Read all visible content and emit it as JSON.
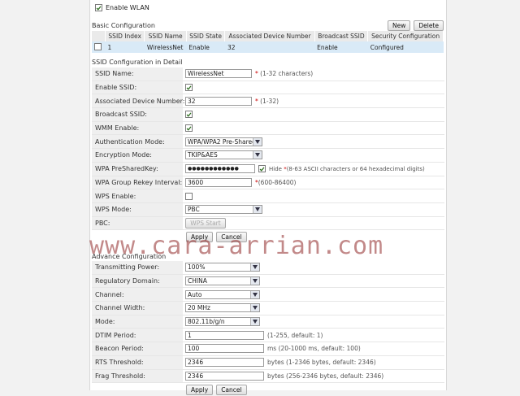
{
  "enable_wlan": {
    "label": "Enable WLAN",
    "checked": true
  },
  "basic": {
    "title": "Basic Configuration",
    "new_label": "New",
    "delete_label": "Delete",
    "columns": [
      "SSID Index",
      "SSID Name",
      "SSID State",
      "Associated Device Number",
      "Broadcast SSID",
      "Security Configuration"
    ],
    "row": {
      "index": "1",
      "name": "WirelessNet",
      "state": "Enable",
      "assoc": "32",
      "broadcast": "Enable",
      "security": "Configured"
    }
  },
  "ssid_detail": {
    "title": "SSID Configuration in Detail",
    "ssid_name_label": "SSID Name:",
    "ssid_name_value": "WirelessNet",
    "ssid_name_note": "(1-32 characters)",
    "enable_ssid_label": "Enable SSID:",
    "assoc_label": "Associated Device Number:",
    "assoc_value": "32",
    "assoc_note": "(1-32)",
    "broadcast_label": "Broadcast SSID:",
    "wmm_label": "WMM Enable:",
    "auth_label": "Authentication Mode:",
    "auth_value": "WPA/WPA2 Pre-Shared",
    "enc_label": "Encryption Mode:",
    "enc_value": "TKIP&AES",
    "psk_label": "WPA PreSharedKey:",
    "psk_value": "●●●●●●●●●●●●",
    "hide_label": "Hide",
    "psk_note": "(8-63 ASCII characters or 64 hexadecimal digits)",
    "rekey_label": "WPA Group Rekey Interval:",
    "rekey_value": "3600",
    "rekey_note": "(600-86400)",
    "wps_enable_label": "WPS Enable:",
    "wps_mode_label": "WPS Mode:",
    "wps_mode_value": "PBC",
    "pbc_label": "PBC:",
    "wps_start_label": "WPS Start",
    "apply_label": "Apply",
    "cancel_label": "Cancel"
  },
  "watermark": "www.cara-arrian.com",
  "advance": {
    "title": "Advance Configuration",
    "power_label": "Transmitting Power:",
    "power_value": "100%",
    "domain_label": "Regulatory Domain:",
    "domain_value": "CHINA",
    "channel_label": "Channel:",
    "channel_value": "Auto",
    "width_label": "Channel Width:",
    "width_value": "20 MHz",
    "mode_label": "Mode:",
    "mode_value": "802.11b/g/n",
    "dtim_label": "DTIM Period:",
    "dtim_value": "1",
    "dtim_note": "(1-255, default: 1)",
    "beacon_label": "Beacon Period:",
    "beacon_value": "100",
    "beacon_note": "ms (20-1000 ms, default: 100)",
    "rts_label": "RTS Threshold:",
    "rts_value": "2346",
    "rts_note": "bytes (1-2346 bytes, default: 2346)",
    "frag_label": "Frag Threshold:",
    "frag_value": "2346",
    "frag_note": "bytes (256-2346 bytes, default: 2346)",
    "apply_label": "Apply",
    "cancel_label": "Cancel"
  }
}
